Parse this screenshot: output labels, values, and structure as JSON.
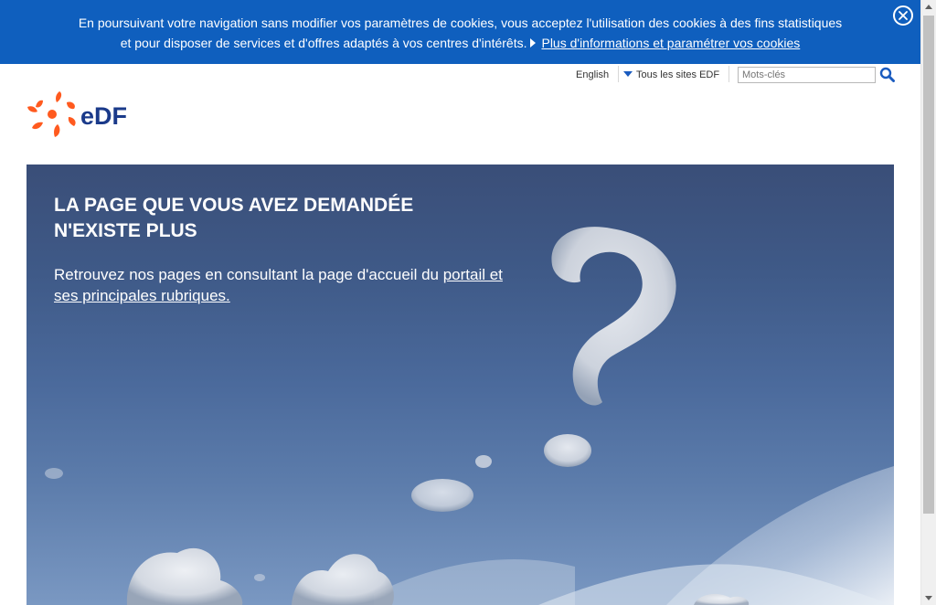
{
  "cookie_banner": {
    "text_line1": "En poursuivant votre navigation sans modifier vos paramètres de cookies, vous acceptez l'utilisation des cookies à des fins statistiques",
    "text_line2": "et pour disposer de services et d'offres adaptés à vos centres d'intérêts.",
    "link_label": "Plus d'informations et paramétrer vos cookies",
    "background_color": "#0f5fbe"
  },
  "utility": {
    "language_link": "English",
    "sites_menu_label": "Tous les sites EDF",
    "search_placeholder": "Mots-clés"
  },
  "logo": {
    "text": "eDF",
    "brand_orange": "#ff5a1f",
    "brand_blue": "#1a3a8a"
  },
  "hero": {
    "title_line1": "LA PAGE QUE VOUS AVEZ DEMANDÉE",
    "title_line2": "N'EXISTE PLUS",
    "text_before_link": "Retrouvez nos pages en consultant la page d'accueil du ",
    "link_label": "portail et ses principales rubriques."
  },
  "icons": {
    "close": "close-icon",
    "search": "search-icon",
    "dropdown": "triangle-down-icon",
    "arrow": "triangle-right-icon"
  }
}
